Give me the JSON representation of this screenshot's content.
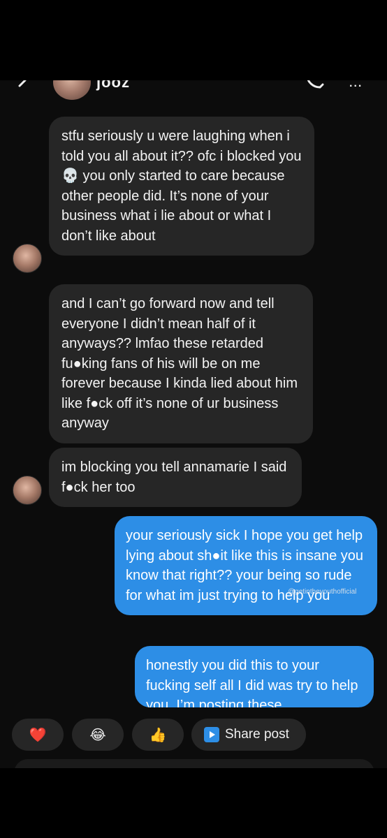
{
  "header": {
    "name": "jooz",
    "back_icon": "chevron-left-icon",
    "call_icon": "phone-icon",
    "more_icon": "more-icon",
    "more_label": "..."
  },
  "messages": [
    {
      "direction": "incoming",
      "text": "stfu seriously u were laughing when i told you all about it?? ofc i blocked you💀 you only started to care because other people did. It’s none of your business what i lie about or what I don’t like about"
    },
    {
      "direction": "incoming",
      "text": "and I can’t go forward now and tell everyone I didn’t mean half of it anyways?? lmfao these retarded fu●king fans of his will be on me forever because I kinda lied about him like f●ck off it’s none of ur business anyway"
    },
    {
      "direction": "incoming",
      "text": "im blocking you tell annamarie I said f●ck her too"
    },
    {
      "direction": "outgoing",
      "text": "your seriously sick I hope you get help lying about sh●it like this is insane you know that right?? your being so rude for what im just trying to help you"
    },
    {
      "direction": "outgoing",
      "text": "honestly you did this to your fucking self all I did was try to help you. I’m posting these"
    }
  ],
  "watermark": "@getintheyouthofficial",
  "reactions": {
    "heart": "❤️",
    "laugh": "😂",
    "thumbs_up": "👍",
    "share_label": "Share post"
  },
  "colors": {
    "incoming_bubble": "#262626",
    "outgoing_bubble": "#2d8ee6",
    "background": "#0c0c0c"
  }
}
